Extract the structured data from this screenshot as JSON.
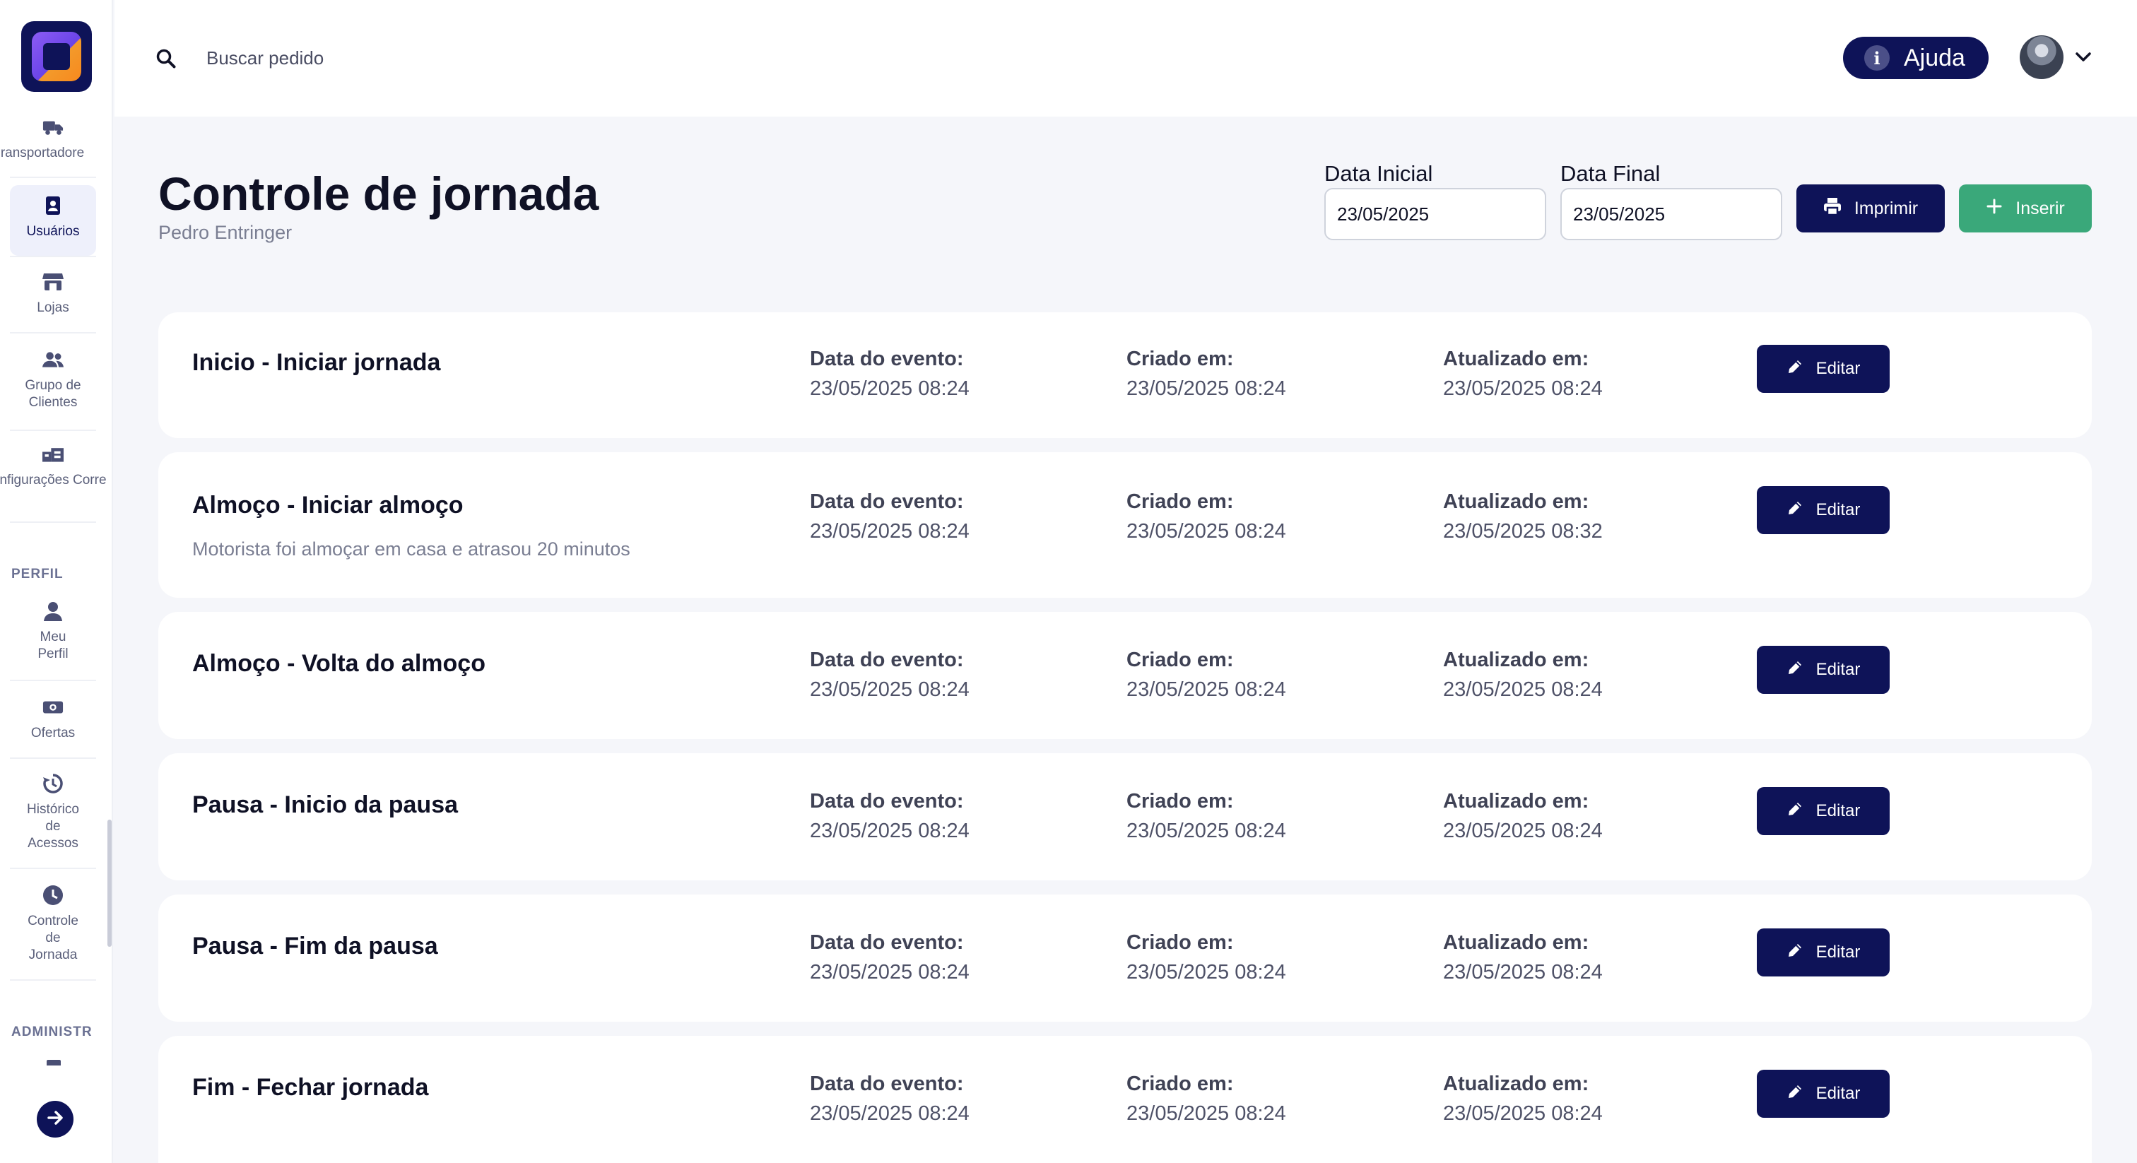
{
  "sidebar": {
    "items": [
      {
        "label": "ransportadore",
        "icon": "truck-icon"
      },
      {
        "label": "Usuários",
        "icon": "user-badge-icon"
      },
      {
        "label": "Lojas",
        "icon": "store-icon"
      },
      {
        "label": "Grupo de Clientes",
        "icon": "users-group-icon"
      },
      {
        "label": "Configurações Correios",
        "icon": "mail-config-icon"
      }
    ],
    "section_profile": "PERFIL",
    "profile_items": [
      {
        "label": "Meu Perfil",
        "icon": "person-icon"
      },
      {
        "label": "Ofertas",
        "icon": "money-icon"
      },
      {
        "label": "Histórico de Acessos",
        "icon": "history-icon"
      },
      {
        "label": "Controle de Jornada",
        "icon": "clock-icon"
      }
    ],
    "section_admin": "ADMINISTR"
  },
  "topbar": {
    "search_placeholder": "Buscar pedido",
    "help_label": "Ajuda"
  },
  "header": {
    "title": "Controle de jornada",
    "subtitle": "Pedro Entringer",
    "date_start_label": "Data Inicial",
    "date_start_value": "23/05/2025",
    "date_end_label": "Data Final",
    "date_end_value": "23/05/2025",
    "print_label": "Imprimir",
    "insert_label": "Inserir"
  },
  "columns": {
    "event": "Data do evento:",
    "created": "Criado em:",
    "updated": "Atualizado em:",
    "edit": "Editar"
  },
  "entries": [
    {
      "title": "Inicio - Iniciar jornada",
      "note": "",
      "event": "23/05/2025 08:24",
      "created": "23/05/2025 08:24",
      "updated": "23/05/2025 08:24"
    },
    {
      "title": "Almoço - Iniciar almoço",
      "note": "Motorista foi almoçar em casa e atrasou 20 minutos",
      "event": "23/05/2025 08:24",
      "created": "23/05/2025 08:24",
      "updated": "23/05/2025 08:32"
    },
    {
      "title": "Almoço - Volta do almoço",
      "note": "",
      "event": "23/05/2025 08:24",
      "created": "23/05/2025 08:24",
      "updated": "23/05/2025 08:24"
    },
    {
      "title": "Pausa - Inicio da pausa",
      "note": "",
      "event": "23/05/2025 08:24",
      "created": "23/05/2025 08:24",
      "updated": "23/05/2025 08:24"
    },
    {
      "title": "Pausa - Fim da pausa",
      "note": "",
      "event": "23/05/2025 08:24",
      "created": "23/05/2025 08:24",
      "updated": "23/05/2025 08:24"
    },
    {
      "title": "Fim - Fechar jornada",
      "note": "",
      "event": "23/05/2025 08:24",
      "created": "23/05/2025 08:24",
      "updated": "23/05/2025 08:24"
    }
  ]
}
